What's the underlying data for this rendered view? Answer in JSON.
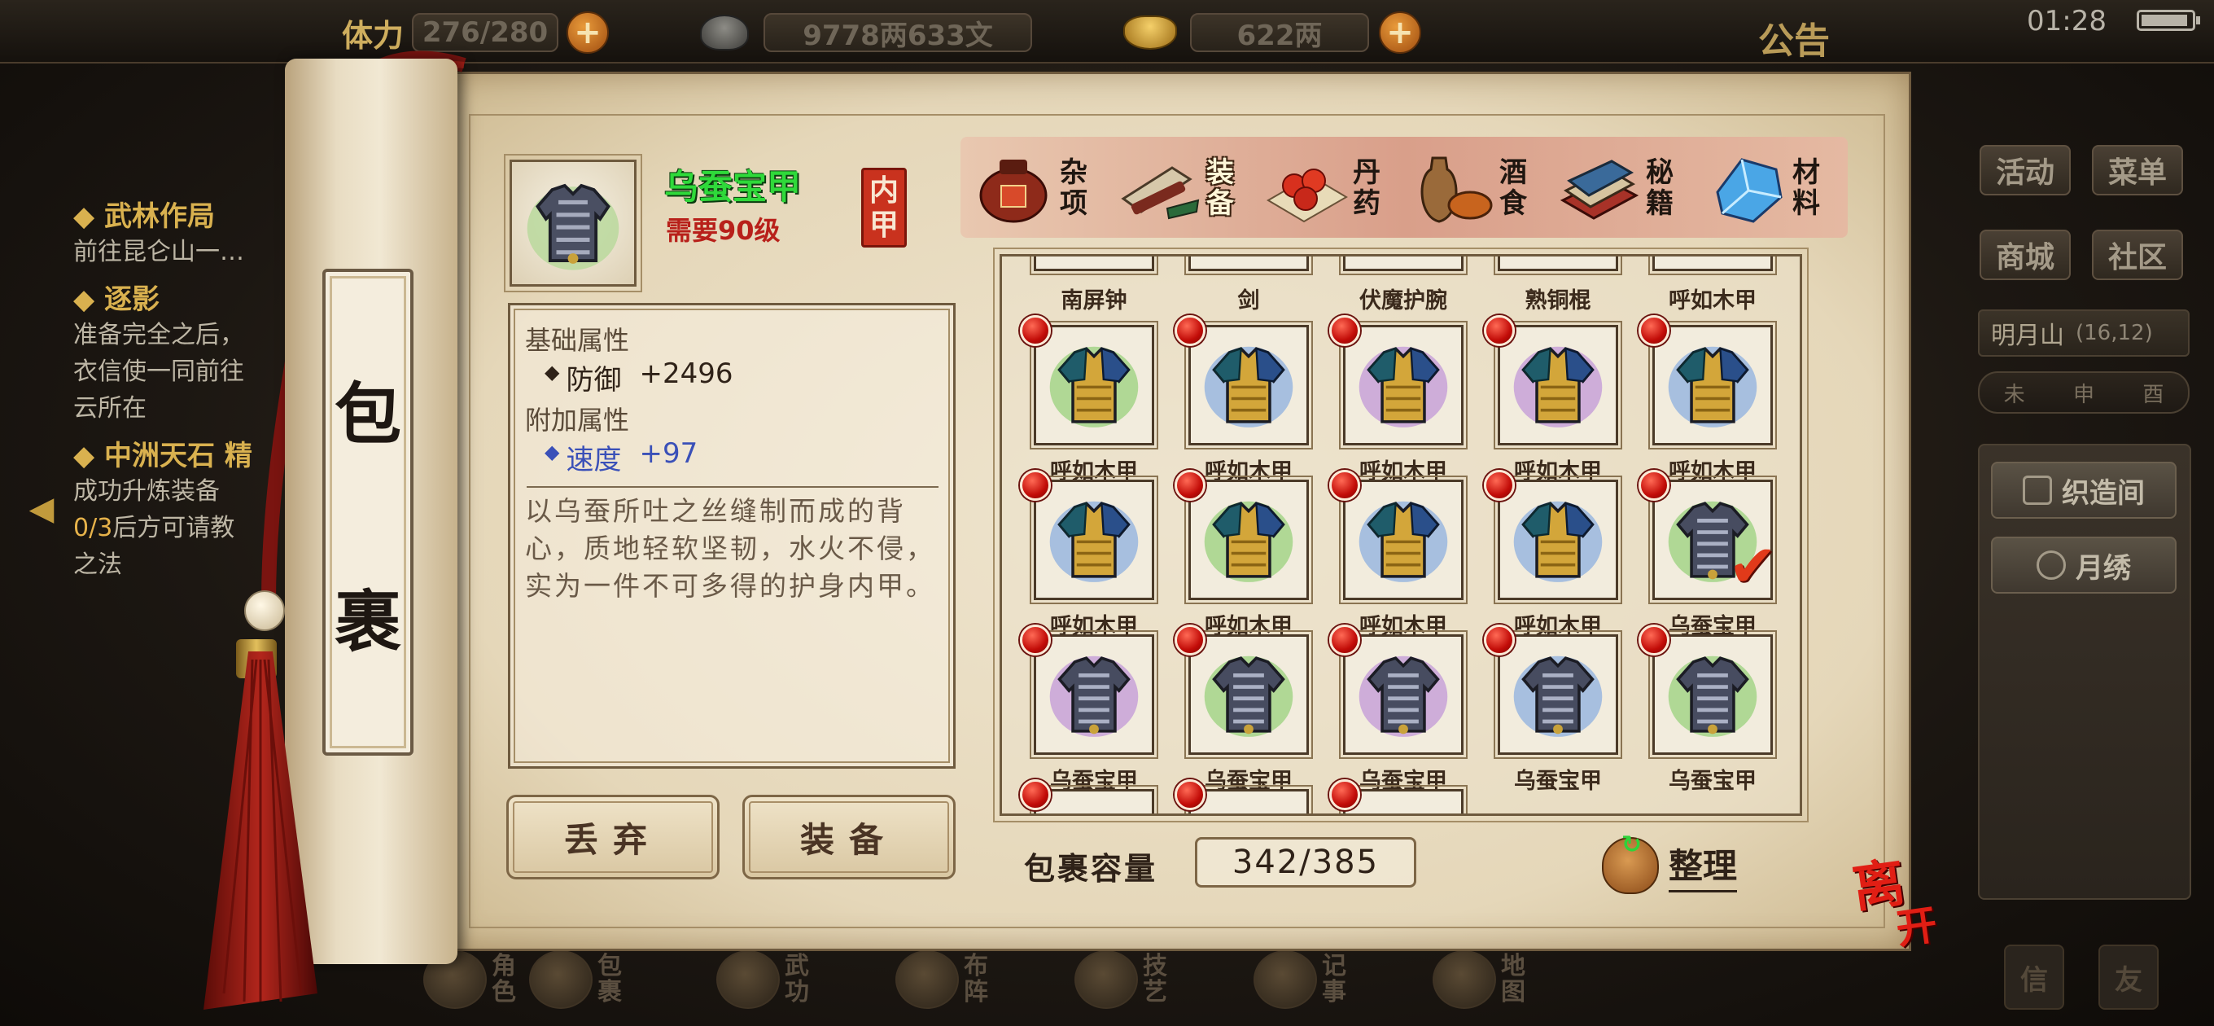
{
  "topbar": {
    "stamina_label": "体力",
    "stamina_value": "276/280",
    "silver_value": "9778两633文",
    "gold_value": "622两",
    "notice_label": "公告",
    "clock": "01:28",
    "plus_symbol": "+"
  },
  "quests": [
    {
      "title": "武林作局",
      "desc": "前往昆仑山一…"
    },
    {
      "title": "逐影",
      "desc": "准备完全之后，\n衣信使一同前往\n云所在"
    },
    {
      "title": "中洲天石 精",
      "desc_pre": "成功升炼装备\n",
      "desc_hl": "0/3",
      "desc_post": "后方可请教\n之法"
    }
  ],
  "right_panel": {
    "buttons": [
      "活动",
      "菜单",
      "商城",
      "社区"
    ],
    "location_name": "明月山",
    "location_coord": "(16,12)",
    "time_marks": [
      "未",
      "申",
      "酉"
    ],
    "shops": [
      "织造间",
      "月绣"
    ]
  },
  "bottom_nav": [
    "角色",
    "包裹",
    "武功",
    "布阵",
    "技艺",
    "记事",
    "地图"
  ],
  "corner_buttons": [
    "信",
    "友"
  ],
  "scroll_title": [
    "包",
    "裹"
  ],
  "item": {
    "name": "乌蚕宝甲",
    "requirement": "需要90级",
    "type_seal": [
      "内",
      "甲"
    ],
    "base_attr_head": "基础属性",
    "base_attr_name": "防御",
    "base_attr_value": "+2496",
    "extra_attr_head": "附加属性",
    "extra_attr_name": "速度",
    "extra_attr_value": "+97",
    "description": "以乌蚕所吐之丝缝制而成的背心，质地轻软坚韧，水火不侵，实为一件不可多得的护身内甲。"
  },
  "actions": {
    "discard": "丢弃",
    "equip": "装备"
  },
  "tabs": [
    {
      "label": "杂项",
      "icon": "jar-icon",
      "color": "#9b3a22"
    },
    {
      "label": "装备",
      "icon": "equipment-icon",
      "color": "#7c6a5a",
      "active": true
    },
    {
      "label": "丹药",
      "icon": "pills-icon",
      "color": "#c43a22"
    },
    {
      "label": "酒食",
      "icon": "wine-food-icon",
      "color": "#8a5a2a"
    },
    {
      "label": "秘籍",
      "icon": "books-icon",
      "color": "#a8322a"
    },
    {
      "label": "材料",
      "icon": "crystal-icon",
      "color": "#3c8fd0"
    }
  ],
  "inventory": {
    "partial_top_labels": [
      "南屏钟",
      "剑",
      "伏魔护腕",
      "熟铜棍",
      "呼如木甲"
    ],
    "rows": [
      [
        {
          "name": "呼如木甲",
          "style": "blue-gold-green",
          "glow": "#7ac85a"
        },
        {
          "name": "呼如木甲",
          "style": "blue-gold-blue",
          "glow": "#6a9be0"
        },
        {
          "name": "呼如木甲",
          "style": "blue-gold-purple",
          "glow": "#b07ad6"
        },
        {
          "name": "呼如木甲",
          "style": "blue-gold-purple",
          "glow": "#b07ad6"
        },
        {
          "name": "呼如木甲",
          "style": "blue-gold-blue",
          "glow": "#6a9be0"
        }
      ],
      [
        {
          "name": "呼如木甲",
          "style": "blue-gold-blue",
          "glow": "#6a9be0"
        },
        {
          "name": "呼如木甲",
          "style": "blue-gold-green",
          "glow": "#7ac85a"
        },
        {
          "name": "呼如木甲",
          "style": "blue-gold-blue",
          "glow": "#6a9be0"
        },
        {
          "name": "呼如木甲",
          "style": "blue-gold-blue",
          "glow": "#6a9be0"
        },
        {
          "name": "乌蚕宝甲",
          "style": "silver-dark",
          "glow": "#7ac85a",
          "selected": true
        }
      ],
      [
        {
          "name": "乌蚕宝甲",
          "style": "silver-dark",
          "glow": "#b07ad6"
        },
        {
          "name": "乌蚕宝甲",
          "style": "silver-dark",
          "glow": "#7ac85a"
        },
        {
          "name": "乌蚕宝甲",
          "style": "silver-dark",
          "glow": "#b07ad6"
        },
        {
          "name": "乌蚕宝甲",
          "style": "silver-dark",
          "glow": "#6a9be0"
        },
        {
          "name": "乌蚕宝甲",
          "style": "silver-dark",
          "glow": "#7ac85a"
        }
      ]
    ],
    "capacity_label": "包裹容量",
    "capacity_value": "342/385",
    "sort_label": "整理"
  },
  "leave_label": [
    "离",
    "开"
  ],
  "colors": {
    "item_name": "#2fd93a",
    "requirement": "#b8201a",
    "alert_dot": "#e0140e",
    "selected_check": "#e13a1a"
  }
}
